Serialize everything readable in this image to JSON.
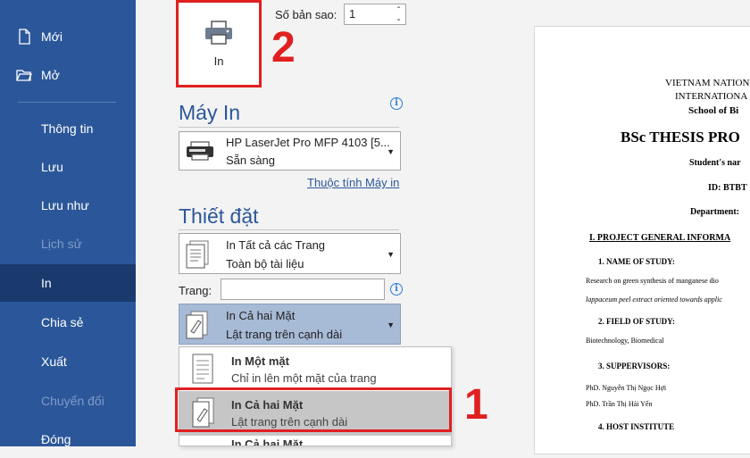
{
  "sidebar": {
    "items": [
      {
        "label": "Mới",
        "icon": "new-document-icon",
        "disabled": false,
        "active": false
      },
      {
        "label": "Mở",
        "icon": "open-folder-icon",
        "disabled": false,
        "active": false
      },
      {
        "label": "Thông tin",
        "disabled": false,
        "active": false
      },
      {
        "label": "Lưu",
        "disabled": false,
        "active": false
      },
      {
        "label": "Lưu như",
        "disabled": false,
        "active": false
      },
      {
        "label": "Lịch sử",
        "disabled": true,
        "active": false
      },
      {
        "label": "In",
        "disabled": false,
        "active": true
      },
      {
        "label": "Chia sẻ",
        "disabled": false,
        "active": false
      },
      {
        "label": "Xuất",
        "disabled": false,
        "active": false
      },
      {
        "label": "Chuyển đổi",
        "disabled": true,
        "active": false
      },
      {
        "label": "Đóng",
        "disabled": false,
        "active": false
      }
    ]
  },
  "print": {
    "button_label": "In",
    "copies_label": "Số bản sao:",
    "copies_value": "1"
  },
  "printer": {
    "title": "Máy In",
    "name": "HP LaserJet Pro MFP 4103 [5...",
    "status": "Sẵn sàng",
    "properties_link": "Thuộc tính Máy in"
  },
  "settings": {
    "title": "Thiết đặt",
    "range_main": "In Tất cả các Trang",
    "range_sub": "Toàn bộ tài liệu",
    "pages_label": "Trang:",
    "pages_value": "",
    "duplex_main": "In Cả hai Mặt",
    "duplex_sub": "Lật trang trên cạnh dài"
  },
  "duplex_menu": {
    "options": [
      {
        "title": "In Một mặt",
        "sub": "Chỉ in lên một mặt của trang"
      },
      {
        "title": "In Cả hai Mặt",
        "sub": "Lật trang trên cạnh dài"
      },
      {
        "title": "In Cả hai Mặt",
        "sub": ""
      }
    ]
  },
  "annotations": {
    "step1": "1",
    "step2": "2"
  },
  "preview": {
    "line1": "VIETNAM NATION",
    "line2": "INTERNATIONA",
    "line3": "School of Bi",
    "title": "BSc THESIS PRO",
    "student": "Student's nar",
    "id": "ID: BTBT",
    "department": "Department:",
    "section1": "I.  PROJECT GENERAL INFORMA",
    "h1": "1.   NAME OF STUDY:",
    "p1a": "Research on green synthesis of manganese dio",
    "p1b": "lappaceum peel extract oriented towards applic",
    "h2": "2.   FIELD OF STUDY:",
    "p2": "Biotechnology, Biomedical",
    "h3": "3.   SUPPERVISORS:",
    "p3a": "PhD.  Nguyễn Thị Ngọc Hợi",
    "p3b": "PhD.  Trần Thị Hải Yến",
    "h4": "4.   HOST INSTITUTE"
  },
  "colors": {
    "sidebar": "#2b579a",
    "accent": "#2b579a",
    "annotation": "#e02020"
  }
}
